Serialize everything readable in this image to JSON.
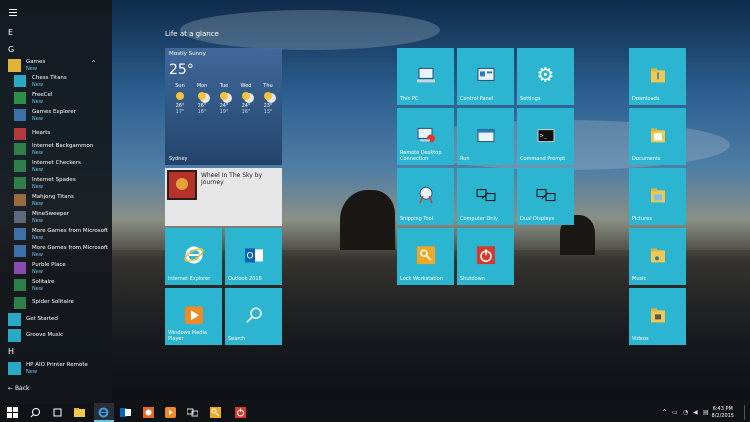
{
  "start_menu": {
    "apps": [
      {
        "letter": "E"
      },
      {
        "letter": "G"
      },
      {
        "name": "Games",
        "new": "New",
        "group": true
      },
      {
        "name": "Chess Titans",
        "new": "New"
      },
      {
        "name": "FreeCel",
        "new": "New"
      },
      {
        "name": "Games Explorer",
        "new": "New"
      },
      {
        "name": "Hearts"
      },
      {
        "name": "Internet Backgammon",
        "new": "New"
      },
      {
        "name": "Internet Checkers",
        "new": "New"
      },
      {
        "name": "Internet Spades",
        "new": "New"
      },
      {
        "name": "Mahjong Titans",
        "new": "New"
      },
      {
        "name": "MineSweeper",
        "new": "New"
      },
      {
        "name": "More Games from Microsoft",
        "new": "New"
      },
      {
        "name": "More Games from Microsoft",
        "new": "New"
      },
      {
        "name": "Purble Place",
        "new": "New"
      },
      {
        "name": "Solitaire",
        "new": "New"
      },
      {
        "name": "Spider Solitaire"
      },
      {
        "name": "Get Started"
      },
      {
        "name": "Groove Music"
      },
      {
        "letter": "H"
      },
      {
        "name": "HP AIO Printer Remote",
        "new": "New"
      }
    ],
    "back_label": "Back"
  },
  "group_label": "Life at a glance",
  "weather": {
    "condition": "Mostly Sunny",
    "temp": "25°",
    "city": "Sydney",
    "days": [
      {
        "day": "Sun",
        "hi": "26°",
        "lo": "17°"
      },
      {
        "day": "Mon",
        "hi": "26°",
        "lo": "16°"
      },
      {
        "day": "Tue",
        "hi": "24°",
        "lo": "19°"
      },
      {
        "day": "Wed",
        "hi": "24°",
        "lo": "16°"
      },
      {
        "day": "Thu",
        "hi": "23°",
        "lo": "13°"
      }
    ]
  },
  "music": {
    "song": "Wheel In The Sky by",
    "artist": "Journey"
  },
  "tiles": {
    "ie": "Internet Explorer",
    "outlook": "Outlook 2016",
    "wmp": "Windows Media Player",
    "search": "Search",
    "this_pc": "This PC",
    "control_panel": "Control Panel",
    "settings": "Settings",
    "remote_desktop": "Remote Desktop Connection",
    "run": "Run",
    "command_prompt": "Command Prompt",
    "snipping_tool": "Snipping Tool",
    "computer_only": "Computer Only",
    "dual_displays": "Dual Displays",
    "lock_workstation": "Lock Workstation",
    "shutdown": "Shutdown",
    "downloads": "Downloads",
    "documents": "Documents",
    "pictures": "Pictures",
    "music": "Music",
    "videos": "Videos"
  },
  "taskbar": {
    "time": "6:43 PM",
    "date": "8/2/2015"
  },
  "colors": {
    "tile": "#2cb5d0",
    "accent": "#6fc3e8"
  }
}
